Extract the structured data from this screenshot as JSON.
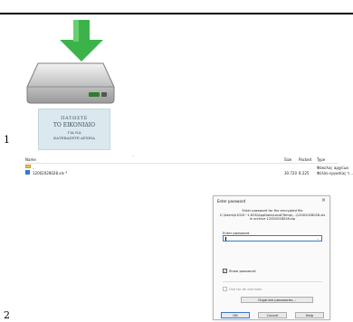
{
  "steps": {
    "one": "1",
    "two": "2"
  },
  "card": {
    "line1": "ΠΑΤΗΣΤΕ",
    "line2": "ΤΟ ΕΙΚΟΝΙΔΙΟ",
    "line3": "ΓΙΑ ΝΑ",
    "line4": "ΚΑΤΕΒΑΣΕΤΕ ΑΡΧΕΙΑ"
  },
  "archive_list": {
    "columns": {
      "name": "Name",
      "size": "Size",
      "packed": "Packed",
      "type": "Type"
    },
    "rows": [
      {
        "name": "..",
        "size": "",
        "packed": "",
        "type": "Φάκελος αρχείων"
      },
      {
        "name": "12002028028.xls *",
        "size": "30.720",
        "packed": "8.225",
        "type": "Φύλλο εργασίας τ..."
      }
    ]
  },
  "dialog": {
    "title": "Enter password",
    "close": "×",
    "message_line1": "Enter password for the encrypted file",
    "message_line2": "C:\\Users\\k1020~1.KOS\\AppData\\Local\\Temp\\...\\12002028028.xls",
    "message_line3": "in archive 12002028028.zip",
    "password_label": "Enter password",
    "show_password_label": "Show password",
    "use_for_all_label": "Use for all archives",
    "organize_button": "Organize passwords...",
    "ok_button": "OK",
    "cancel_button": "Cancel",
    "help_button": "Help"
  }
}
